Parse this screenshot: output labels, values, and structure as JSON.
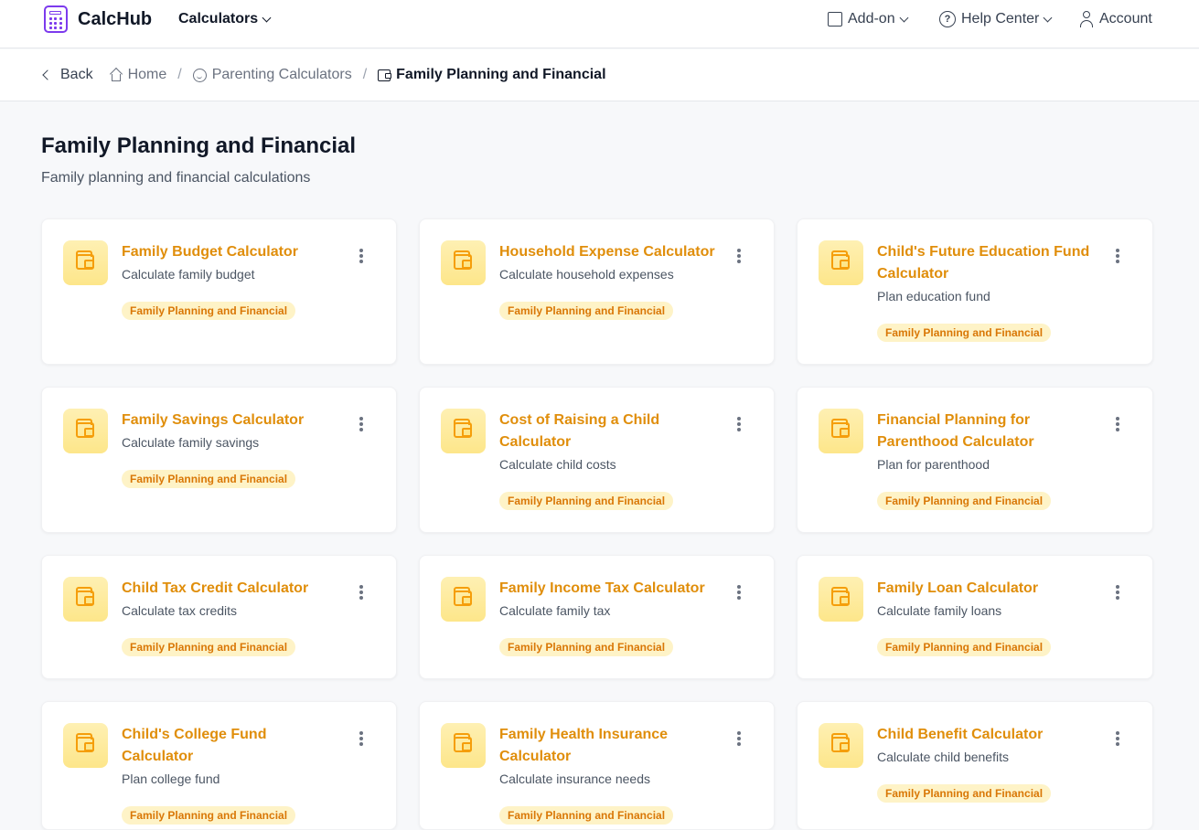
{
  "header": {
    "brand": "CalcHub",
    "nav_calculators": "Calculators",
    "addon": "Add-on",
    "help": "Help Center",
    "account": "Account"
  },
  "breadcrumb": {
    "back": "Back",
    "home": "Home",
    "parent": "Parenting Calculators",
    "current": "Family Planning and Financial"
  },
  "page": {
    "title": "Family Planning and Financial",
    "subtitle": "Family planning and financial calculations"
  },
  "colors": {
    "accent": "#e08e0b",
    "tag_bg": "#fef3c7",
    "icon_bg": "#fde68a",
    "brand_icon": "#7c3aed"
  },
  "cards": [
    {
      "title": "Family Budget Calculator",
      "desc": "Calculate family budget",
      "tag": "Family Planning and Financial",
      "icon": "wallet-icon"
    },
    {
      "title": "Household Expense Calculator",
      "desc": "Calculate household expenses",
      "tag": "Family Planning and Financial",
      "icon": "wallet-icon"
    },
    {
      "title": "Child's Future Education Fund Calculator",
      "desc": "Plan education fund",
      "tag": "Family Planning and Financial",
      "icon": "wallet-icon"
    },
    {
      "title": "Family Savings Calculator",
      "desc": "Calculate family savings",
      "tag": "Family Planning and Financial",
      "icon": "wallet-icon"
    },
    {
      "title": "Cost of Raising a Child Calculator",
      "desc": "Calculate child costs",
      "tag": "Family Planning and Financial",
      "icon": "wallet-icon"
    },
    {
      "title": "Financial Planning for Parenthood Calculator",
      "desc": "Plan for parenthood",
      "tag": "Family Planning and Financial",
      "icon": "wallet-icon"
    },
    {
      "title": "Child Tax Credit Calculator",
      "desc": "Calculate tax credits",
      "tag": "Family Planning and Financial",
      "icon": "wallet-icon"
    },
    {
      "title": "Family Income Tax Calculator",
      "desc": "Calculate family tax",
      "tag": "Family Planning and Financial",
      "icon": "wallet-icon"
    },
    {
      "title": "Family Loan Calculator",
      "desc": "Calculate family loans",
      "tag": "Family Planning and Financial",
      "icon": "wallet-icon"
    },
    {
      "title": "Child's College Fund Calculator",
      "desc": "Plan college fund",
      "tag": "Family Planning and Financial",
      "icon": "wallet-icon"
    },
    {
      "title": "Family Health Insurance Calculator",
      "desc": "Calculate insurance needs",
      "tag": "Family Planning and Financial",
      "icon": "wallet-icon"
    },
    {
      "title": "Child Benefit Calculator",
      "desc": "Calculate child benefits",
      "tag": "Family Planning and Financial",
      "icon": "wallet-icon"
    }
  ]
}
